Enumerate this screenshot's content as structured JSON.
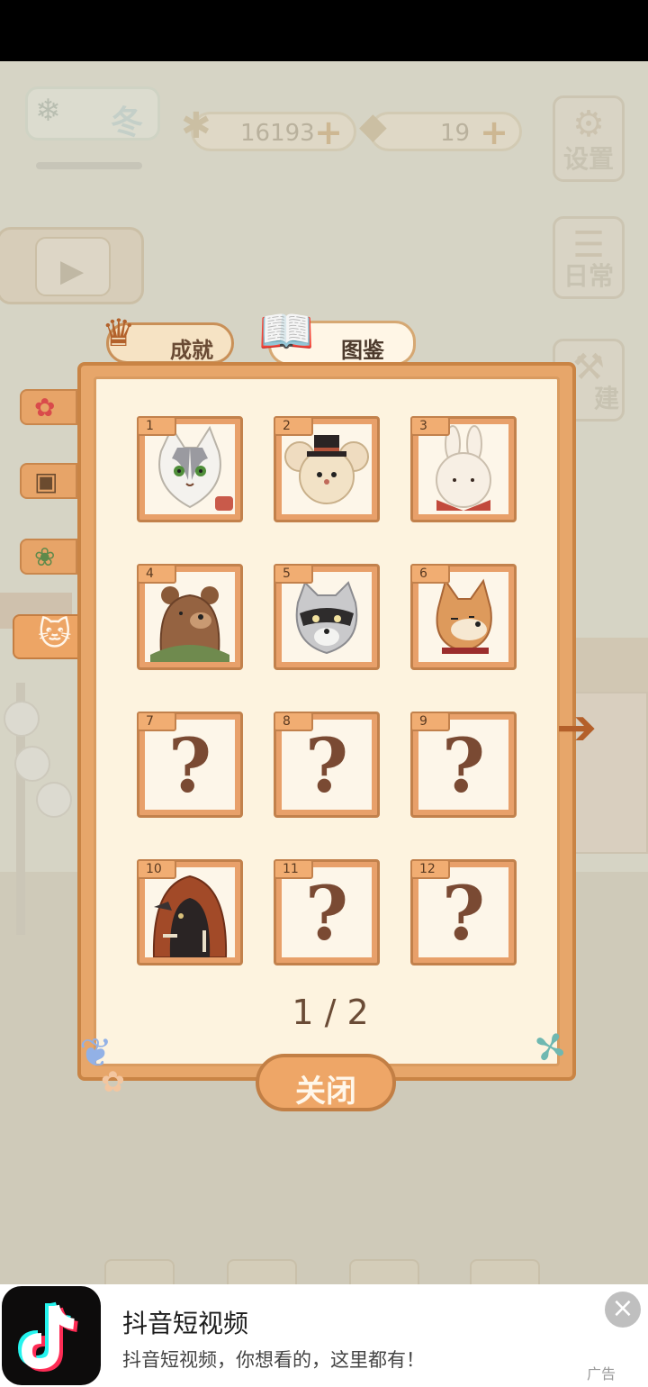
{
  "game": {
    "season": {
      "label": "冬"
    },
    "fish_count": "16193",
    "cheese_count": "19",
    "settings_label": "设置",
    "daily_label": "日常",
    "build_label": "建"
  },
  "tabs": [
    {
      "label": "成就",
      "icon": "trophy-icon"
    },
    {
      "label": "图鉴",
      "icon": "book-icon"
    }
  ],
  "categories": [
    {
      "icon": "rose-icon"
    },
    {
      "icon": "photo-icon"
    },
    {
      "icon": "bouquet-icon"
    },
    {
      "icon": "cat-silhouette-icon"
    }
  ],
  "catalog": {
    "entries": [
      {
        "num": "1",
        "creature": "cat"
      },
      {
        "num": "2",
        "creature": "mouse"
      },
      {
        "num": "3",
        "creature": "rabbit"
      },
      {
        "num": "4",
        "creature": "bear"
      },
      {
        "num": "5",
        "creature": "raccoon"
      },
      {
        "num": "6",
        "creature": "shiba"
      },
      {
        "num": "7",
        "creature": "unknown",
        "mark": "?"
      },
      {
        "num": "8",
        "creature": "unknown",
        "mark": "?"
      },
      {
        "num": "9",
        "creature": "unknown",
        "mark": "?"
      },
      {
        "num": "10",
        "creature": "crow"
      },
      {
        "num": "11",
        "creature": "unknown",
        "mark": "?"
      },
      {
        "num": "12",
        "creature": "unknown",
        "mark": "?"
      }
    ],
    "page": "1 / 2",
    "close_label": "关闭"
  },
  "ad": {
    "title": "抖音短视频",
    "description": "抖音短视频，你想看的，这里都有！",
    "tag": "广告",
    "close": "×"
  },
  "colors": {
    "panel": "#e7a66a",
    "panel_inner": "#fdf3df",
    "accent_brown": "#7a4a33"
  }
}
